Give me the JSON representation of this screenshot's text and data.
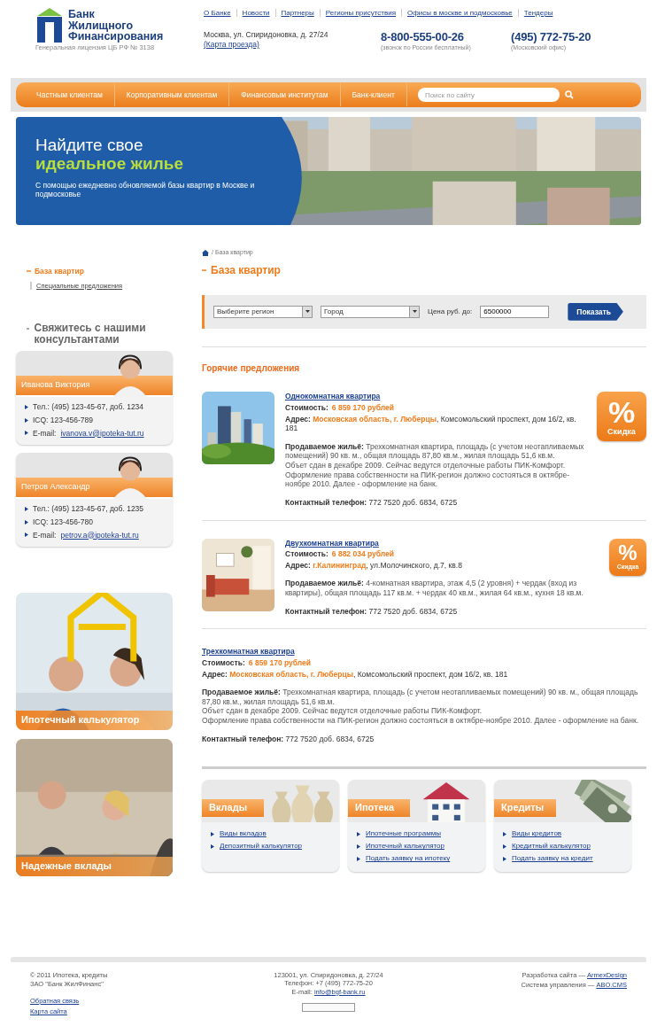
{
  "header": {
    "logo": {
      "name_lines": [
        "Банк",
        "Жилищного",
        "Финансирования"
      ],
      "license": "Генеральная лицензия ЦБ РФ № 3138"
    },
    "top_links": [
      "О Банке",
      "Новости",
      "Партнеры",
      "Регионы присутствия",
      "Офисы в москве и подмосковье",
      "Тендеры"
    ],
    "address": "Москва, ул. Спиридоновка, д. 27/24",
    "map_link": "(Карта проезда)",
    "phones": [
      {
        "number": "8-800-555-00-26",
        "note": "(звонок по России бесплатный)"
      },
      {
        "number": "(495) 772-75-20",
        "note": "(Московский офис)"
      }
    ]
  },
  "nav": {
    "items": [
      "Частным клиентам",
      "Корпоративным клиентам",
      "Финансовым институтам",
      "Банк-клиент"
    ],
    "search": {
      "placeholder": "Поиск по сайту"
    }
  },
  "banner": {
    "title_lines": [
      "Найдите свое",
      "идеальное жилье"
    ],
    "subtitle": "С помощью ежедневно обновляемой базы квартир в Москве и подмосковье"
  },
  "sidebar": {
    "menu": [
      {
        "label": "База квартир",
        "selected": true,
        "children": [
          {
            "label": "Специальные предложения",
            "selected": false
          }
        ]
      }
    ],
    "contact_heading": "Свяжитесь с нашими консультантами",
    "consultants": [
      {
        "name": "Иванова Виктория",
        "lines": [
          {
            "kind": "text",
            "text": "Тел.: (495) 123-45-67, доб. 1234"
          },
          {
            "kind": "text",
            "text": "ICQ: 123-456-789"
          },
          {
            "kind": "email",
            "label": "E-mail:",
            "link": "ivanova.v@ipoteka-tut.ru"
          }
        ]
      },
      {
        "name": "Петров Александр",
        "lines": [
          {
            "kind": "text",
            "text": "Тел.: (495) 123-45-67, доб. 1235"
          },
          {
            "kind": "text",
            "text": "ICQ: 123-456-780"
          },
          {
            "kind": "email",
            "label": "E-mail:",
            "link": "petrov.a@ipoteka-tut.ru"
          }
        ]
      }
    ],
    "promos": [
      {
        "caption": "Ипотечный калькулятор"
      },
      {
        "caption": "Надежные вклады"
      }
    ]
  },
  "main": {
    "breadcrumb": "/ База квартир",
    "title": "База квартир",
    "filter": {
      "region": "Выберите регион",
      "city": "Город",
      "price_label": "Цена руб. до:",
      "price_value": "6500000",
      "submit": "Показать"
    },
    "hot_heading": "Горячие предложения",
    "listings": [
      {
        "title": "Однокомнатная квартира",
        "media": {
          "kind": "picture"
        },
        "cost_label": "Стоимость:",
        "cost": "6 859 170 рублей",
        "address_label": "Адрес:",
        "address_place": "Московская область, г. Люберцы",
        "address_rest": ", Комсомольский проспект, дом 16/2, кв. 181",
        "description": [
          "**Продаваемое жильё:** Трехкомнатная квартира, площадь (с учетом неотапливаемых помещений) 90 кв. м., общая площадь 87,80 кв.м., жилая площадь 51,6 кв.м.",
          "Объет сдан в декабре 2009. Сейчас ведутся отделочные работы ПИК-Комфорт.",
          "Оформление права собственности на ПИК-регион должно состояться в октябре-ноябре 2010. Далее - оформление на банк."
        ],
        "contact_label": "Контактный телефон:",
        "contact": "772 7520 доб. 6834, 6725",
        "discount": {
          "symbol": "%",
          "label": "Скидка"
        }
      },
      {
        "title": "Двухкомнатная квартира",
        "media": {
          "kind": "picture"
        },
        "cost_label": "Стоимость:",
        "cost": "6 882 034 рублей",
        "address_label": "Адрес:",
        "address_place": "г.Калининград",
        "address_rest": ", ул.Молочинского, д.7, кв.8",
        "description": [
          "**Продаваемое жильё:** 4-комнатная квартира, этаж 4,5 (2 уровня) + чердак (вход из квартиры), общая площадь 117 кв.м. + чердак 40 кв.м., жилая 64 кв.м., кухня 18 кв.м."
        ],
        "contact_label": "Контактный телефон:",
        "contact": "772 7520 доб. 6834, 6725",
        "discount": {
          "symbol": "%",
          "label": "Скидка"
        }
      },
      {
        "title": "Трехкомнатная квартира",
        "cost_label": "Стоимость:",
        "cost": "6 859 170 рублей",
        "address_label": "Адрес:",
        "address_place": "Московская область, г. Люберцы",
        "address_rest": ", Комсомольский проспект, дом 16/2, кв. 181",
        "description": [
          "**Продаваемое жильё:** Трехкомнатная квартира, площадь (с учетом неотапливаемых помещений) 90 кв. м., общая площадь 87,80 кв.м., жилая площадь 51,6 кв.м.",
          "Объет сдан в декабре 2009. Сейчас ведутся отделочные работы ПИК-Комфорт.",
          "Оформление права собственности на ПИК-регион должно состояться в октябре-ноябре 2010. Далее - оформление на банк."
        ],
        "contact_label": "Контактный телефон:",
        "contact": "772 7520 доб. 6834, 6725"
      }
    ],
    "services": [
      {
        "title": "Вклады",
        "links": [
          "Виды вкладов",
          "Депозитный калькулятор"
        ]
      },
      {
        "title": "Ипотека",
        "links": [
          "Ипотечные программы",
          "Ипотечный калькулятор",
          "Подать заявку на ипотеку"
        ]
      },
      {
        "title": "Кредиты",
        "links": [
          "Виды кредитов",
          "Кредитный калькулятор",
          "Подать заявку на кредит"
        ]
      }
    ]
  },
  "footer": {
    "left": [
      "© 2011 Ипотека, кредиты",
      "ЗАО \"Банк ЖилФинанс\""
    ],
    "left_links": [
      "Обратная связь",
      "Карта сайта"
    ],
    "center": [
      "123001, ул. Спиридоновка, д. 27/24",
      "Телефон: +7 (495) 772-75-20"
    ],
    "email_label": "E-mail:",
    "email": "info@bgf-bank.ru",
    "credits": [
      {
        "label": "Разработка сайта —",
        "link": "ArmexDesign"
      },
      {
        "label": "Система управления —",
        "link": "ABO.CMS"
      }
    ]
  }
}
